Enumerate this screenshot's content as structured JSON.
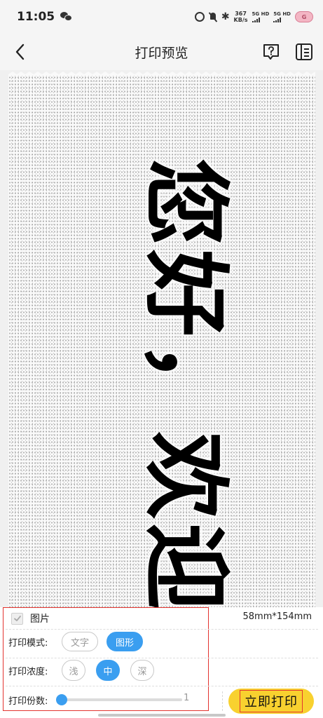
{
  "status_bar": {
    "time": "11:05",
    "net_speed_value": "367",
    "net_speed_unit": "KB/s",
    "sim1": "5G HD",
    "sim2": "5G HD",
    "battery": "G"
  },
  "nav": {
    "title": "打印预览"
  },
  "preview": {
    "text": "您好，欢迎使"
  },
  "panel": {
    "image_label": "图片",
    "image_checked": true,
    "paper_size": "58mm*154mm",
    "mode": {
      "label": "打印模式:",
      "options": [
        "文字",
        "图形"
      ],
      "selected": "图形"
    },
    "density": {
      "label": "打印浓度:",
      "options": [
        "浅",
        "中",
        "深"
      ],
      "selected": "中"
    },
    "copies": {
      "label": "打印份数:",
      "value": "1",
      "slider_fraction": 0
    },
    "print_button": "立即打印"
  },
  "colors": {
    "accent": "#3a9ef0",
    "print_button": "#f8d12f",
    "highlight": "#e3342f"
  }
}
